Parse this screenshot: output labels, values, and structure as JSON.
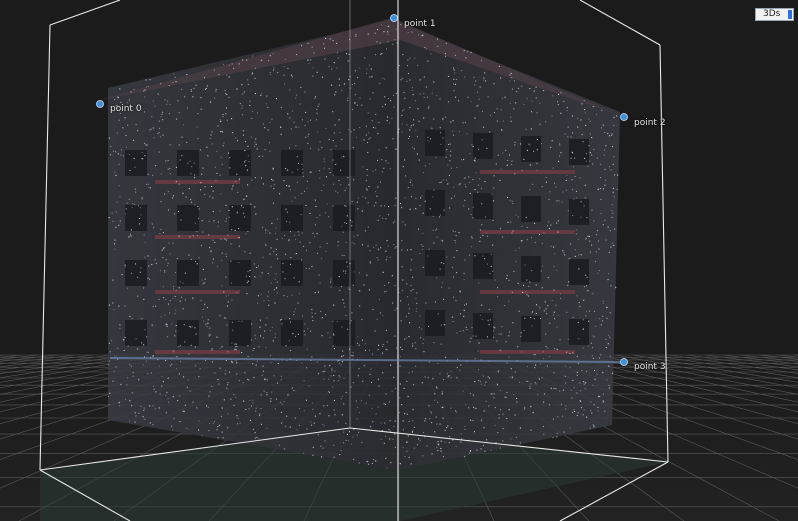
{
  "viewer": {
    "mode_label": "3Ds",
    "colors": {
      "background": "#1b1b1b",
      "grid": "#5a5a5a",
      "bbox": "#e8e8e8",
      "marker": "#3f8fd8",
      "point_cloud": "#d8dce8"
    }
  },
  "points": [
    {
      "label": "point 0"
    },
    {
      "label": "point 1"
    },
    {
      "label": "point 2"
    },
    {
      "label": "point 3"
    }
  ]
}
